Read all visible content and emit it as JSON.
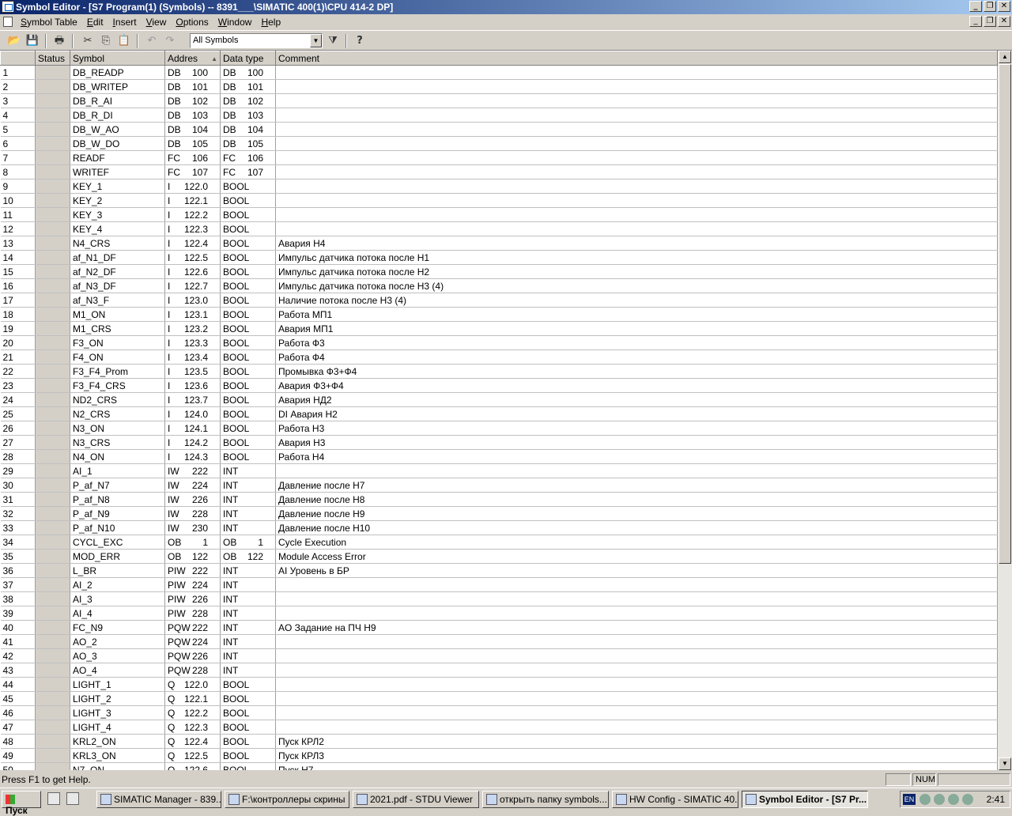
{
  "window": {
    "title": "Symbol Editor - [S7 Program(1) (Symbols) -- 8391___\\SIMATIC 400(1)\\CPU 414-2 DP]"
  },
  "menu": [
    {
      "label": "Symbol Table",
      "u": "S"
    },
    {
      "label": "Edit",
      "u": "E"
    },
    {
      "label": "Insert",
      "u": "I"
    },
    {
      "label": "View",
      "u": "V"
    },
    {
      "label": "Options",
      "u": "O"
    },
    {
      "label": "Window",
      "u": "W"
    },
    {
      "label": "Help",
      "u": "H"
    }
  ],
  "toolbar": {
    "filter_value": "All Symbols"
  },
  "columns": {
    "status": "Status",
    "symbol": "Symbol",
    "address": "Addres",
    "datatype": "Data type",
    "comment": "Comment"
  },
  "rows": [
    [
      "1",
      "DB_READP",
      "DB",
      "100",
      "DB",
      "100",
      ""
    ],
    [
      "2",
      "DB_WRITEP",
      "DB",
      "101",
      "DB",
      "101",
      ""
    ],
    [
      "3",
      "DB_R_AI",
      "DB",
      "102",
      "DB",
      "102",
      ""
    ],
    [
      "4",
      "DB_R_DI",
      "DB",
      "103",
      "DB",
      "103",
      ""
    ],
    [
      "5",
      "DB_W_AO",
      "DB",
      "104",
      "DB",
      "104",
      ""
    ],
    [
      "6",
      "DB_W_DO",
      "DB",
      "105",
      "DB",
      "105",
      ""
    ],
    [
      "7",
      "READF",
      "FC",
      "106",
      "FC",
      "106",
      ""
    ],
    [
      "8",
      "WRITEF",
      "FC",
      "107",
      "FC",
      "107",
      ""
    ],
    [
      "9",
      "KEY_1",
      "I",
      "122.0",
      "BOOL",
      "",
      ""
    ],
    [
      "10",
      "KEY_2",
      "I",
      "122.1",
      "BOOL",
      "",
      ""
    ],
    [
      "11",
      "KEY_3",
      "I",
      "122.2",
      "BOOL",
      "",
      ""
    ],
    [
      "12",
      "KEY_4",
      "I",
      "122.3",
      "BOOL",
      "",
      ""
    ],
    [
      "13",
      "N4_CRS",
      "I",
      "122.4",
      "BOOL",
      "",
      "Авария Н4"
    ],
    [
      "14",
      "af_N1_DF",
      "I",
      "122.5",
      "BOOL",
      "",
      "Импульс датчика потока после Н1"
    ],
    [
      "15",
      "af_N2_DF",
      "I",
      "122.6",
      "BOOL",
      "",
      "Импульс датчика потока после Н2"
    ],
    [
      "16",
      "af_N3_DF",
      "I",
      "122.7",
      "BOOL",
      "",
      "Импульс датчика потока после Н3 (4)"
    ],
    [
      "17",
      "af_N3_F",
      "I",
      "123.0",
      "BOOL",
      "",
      "Наличие потока после Н3 (4)"
    ],
    [
      "18",
      "M1_ON",
      "I",
      "123.1",
      "BOOL",
      "",
      "Работа МП1"
    ],
    [
      "19",
      "M1_CRS",
      "I",
      "123.2",
      "BOOL",
      "",
      "Авария МП1"
    ],
    [
      "20",
      "F3_ON",
      "I",
      "123.3",
      "BOOL",
      "",
      "Работа Ф3"
    ],
    [
      "21",
      "F4_ON",
      "I",
      "123.4",
      "BOOL",
      "",
      "Работа Ф4"
    ],
    [
      "22",
      "F3_F4_Prom",
      "I",
      "123.5",
      "BOOL",
      "",
      "Промывка Ф3+Ф4"
    ],
    [
      "23",
      "F3_F4_CRS",
      "I",
      "123.6",
      "BOOL",
      "",
      "Авария Ф3+Ф4"
    ],
    [
      "24",
      "ND2_CRS",
      "I",
      "123.7",
      "BOOL",
      "",
      "Авария НД2"
    ],
    [
      "25",
      "N2_CRS",
      "I",
      "124.0",
      "BOOL",
      "",
      "DI Авария Н2"
    ],
    [
      "26",
      "N3_ON",
      "I",
      "124.1",
      "BOOL",
      "",
      "Работа Н3"
    ],
    [
      "27",
      "N3_CRS",
      "I",
      "124.2",
      "BOOL",
      "",
      "Авария Н3"
    ],
    [
      "28",
      "N4_ON",
      "I",
      "124.3",
      "BOOL",
      "",
      "Работа Н4"
    ],
    [
      "29",
      "AI_1",
      "IW",
      "222",
      "INT",
      "",
      ""
    ],
    [
      "30",
      "P_af_N7",
      "IW",
      "224",
      "INT",
      "",
      "Давление после Н7"
    ],
    [
      "31",
      "P_af_N8",
      "IW",
      "226",
      "INT",
      "",
      "Давление после Н8"
    ],
    [
      "32",
      "P_af_N9",
      "IW",
      "228",
      "INT",
      "",
      "Давление после Н9"
    ],
    [
      "33",
      "P_af_N10",
      "IW",
      "230",
      "INT",
      "",
      "Давление после Н10"
    ],
    [
      "34",
      "CYCL_EXC",
      "OB",
      "1",
      "OB",
      "1",
      "Cycle Execution"
    ],
    [
      "35",
      "MOD_ERR",
      "OB",
      "122",
      "OB",
      "122",
      "Module Access Error"
    ],
    [
      "36",
      "L_BR",
      "PIW",
      "222",
      "INT",
      "",
      "AI Уровень в БР"
    ],
    [
      "37",
      "AI_2",
      "PIW",
      "224",
      "INT",
      "",
      ""
    ],
    [
      "38",
      "AI_3",
      "PIW",
      "226",
      "INT",
      "",
      ""
    ],
    [
      "39",
      "AI_4",
      "PIW",
      "228",
      "INT",
      "",
      ""
    ],
    [
      "40",
      "FC_N9",
      "PQW",
      "222",
      "INT",
      "",
      "AO Задание на ПЧ Н9"
    ],
    [
      "41",
      "AO_2",
      "PQW",
      "224",
      "INT",
      "",
      ""
    ],
    [
      "42",
      "AO_3",
      "PQW",
      "226",
      "INT",
      "",
      ""
    ],
    [
      "43",
      "AO_4",
      "PQW",
      "228",
      "INT",
      "",
      ""
    ],
    [
      "44",
      "LIGHT_1",
      "Q",
      "122.0",
      "BOOL",
      "",
      ""
    ],
    [
      "45",
      "LIGHT_2",
      "Q",
      "122.1",
      "BOOL",
      "",
      ""
    ],
    [
      "46",
      "LIGHT_3",
      "Q",
      "122.2",
      "BOOL",
      "",
      ""
    ],
    [
      "47",
      "LIGHT_4",
      "Q",
      "122.3",
      "BOOL",
      "",
      ""
    ],
    [
      "48",
      "KRL2_ON",
      "Q",
      "122.4",
      "BOOL",
      "",
      "Пуск КРЛ2"
    ],
    [
      "49",
      "KRL3_ON",
      "Q",
      "122.5",
      "BOOL",
      "",
      "Пуск КРЛ3"
    ],
    [
      "50",
      "N7_ON",
      "Q",
      "122.6",
      "BOOL",
      "",
      "Пуск Н7"
    ]
  ],
  "status": {
    "help_text": "Press F1 to get Help.",
    "num": "NUM"
  },
  "taskbar": {
    "start": "Пуск",
    "tasks": [
      "SIMATIC Manager - 839...",
      "F:\\контроллеры скрины",
      "2021.pdf - STDU Viewer",
      "открыть папку symbols...",
      "HW Config - SIMATIC 40...",
      "Symbol Editor - [S7 Pr..."
    ],
    "lang": "EN",
    "clock": "2:41"
  }
}
